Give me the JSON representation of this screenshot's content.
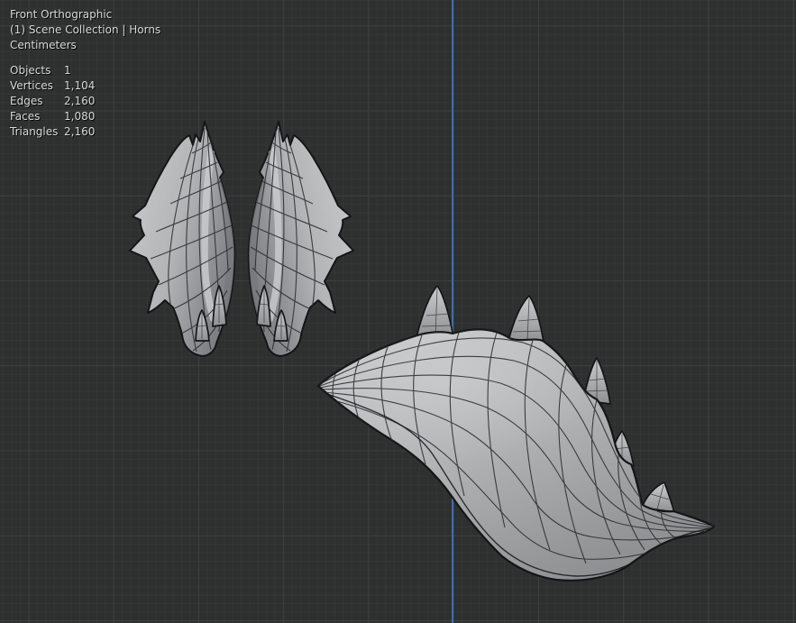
{
  "viewport": {
    "header": {
      "view_label": "Front Orthographic",
      "breadcrumb": "(1) Scene Collection | Horns",
      "units": "Centimeters"
    },
    "stats": {
      "rows": [
        {
          "label": "Objects",
          "value": "1"
        },
        {
          "label": "Vertices",
          "value": "1,104"
        },
        {
          "label": "Edges",
          "value": "2,160"
        },
        {
          "label": "Faces",
          "value": "1,080"
        },
        {
          "label": "Triangles",
          "value": "2,160"
        }
      ]
    },
    "objects": [
      {
        "name": "horn-mesh-left",
        "description": "spiked horn blade, wireframe shaded"
      },
      {
        "name": "horn-mesh-right",
        "description": "mirrored spiked horn blade, wireframe shaded"
      },
      {
        "name": "horn-mesh-large",
        "description": "large curved horn with five spikes, wireframe shaded"
      }
    ]
  },
  "colors": {
    "background": "#2e2f2f",
    "grid-minor": "#343535",
    "grid-major": "#3e3f3f",
    "axis-z": "#4272b0",
    "mesh-fill-light": "#cbcdcf",
    "mesh-fill": "#b2b4b6",
    "mesh-fill-dark": "#8e9092",
    "wire": "#2e2f31",
    "outline": "#141517",
    "overlay-text": "#d9d9d9"
  }
}
